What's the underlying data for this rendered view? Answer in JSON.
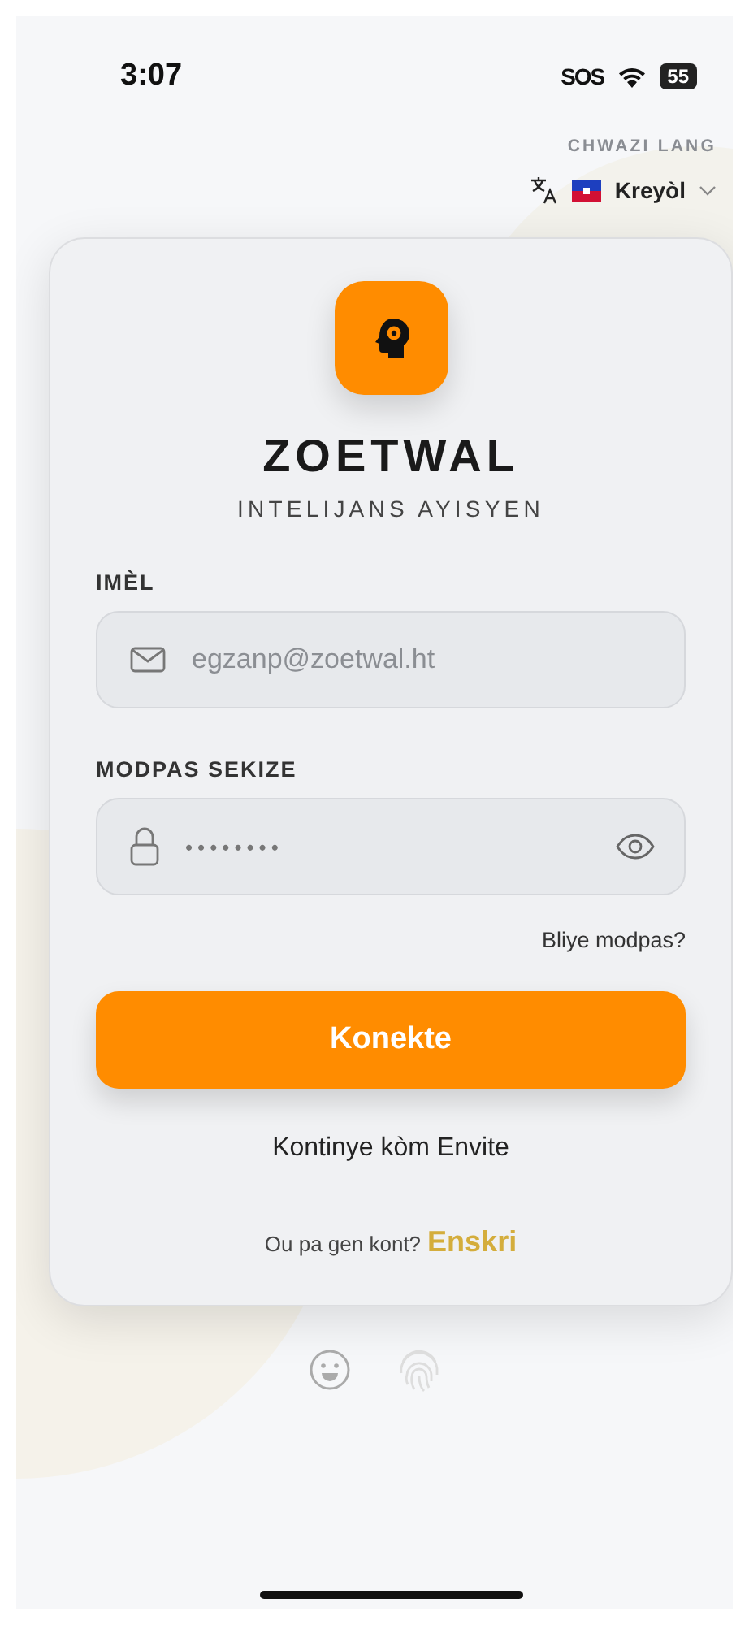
{
  "status_bar": {
    "time": "3:07",
    "sos": "SOS",
    "battery": "55"
  },
  "language": {
    "label": "CHWAZI LANG",
    "selected": "Kreyòl"
  },
  "brand": {
    "name": "ZOETWAL",
    "tagline": "INTELIJANS AYISYEN"
  },
  "fields": [
    {
      "kind": "email",
      "label": "IMÈL",
      "placeholder": "egzanp@zoetwal.ht"
    },
    {
      "kind": "password",
      "label": "MODPAS SEKIZE",
      "value": "••••••••"
    }
  ],
  "forgot_link": "Bliye modpas?",
  "login_button": "Konekte",
  "guest_link": "Kontinye kòm Envite",
  "signup": {
    "prompt": "Ou pa gen kont?",
    "link": "Enskri"
  }
}
